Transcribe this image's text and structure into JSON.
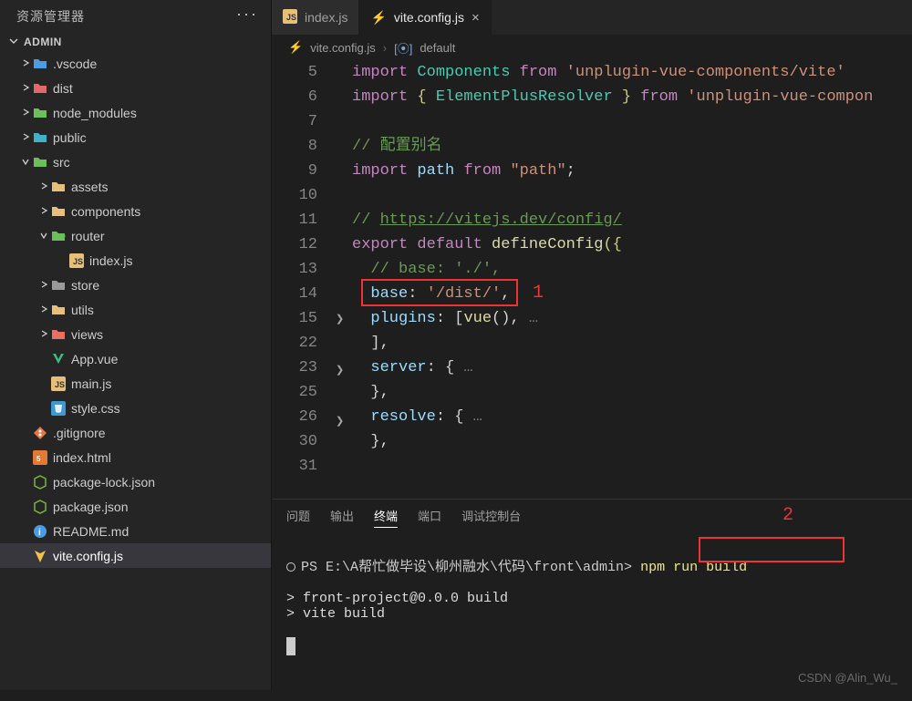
{
  "sidebar": {
    "title": "资源管理器",
    "project": "ADMIN",
    "tree": [
      {
        "chev": ">",
        "icon": "folder-vscode",
        "color": "#4a9de0",
        "label": ".vscode",
        "ind": 1
      },
      {
        "chev": ">",
        "icon": "folder-dist",
        "color": "#e06a6a",
        "label": "dist",
        "ind": 1
      },
      {
        "chev": ">",
        "icon": "folder-node",
        "color": "#6dbd5a",
        "label": "node_modules",
        "ind": 1
      },
      {
        "chev": ">",
        "icon": "folder-public",
        "color": "#3fb1c8",
        "label": "public",
        "ind": 1
      },
      {
        "chev": "v",
        "icon": "folder-src",
        "color": "#6dbd5a",
        "label": "src",
        "ind": 1
      },
      {
        "chev": ">",
        "icon": "folder",
        "color": "#e6c07b",
        "label": "assets",
        "ind": 2
      },
      {
        "chev": ">",
        "icon": "folder",
        "color": "#e6c07b",
        "label": "components",
        "ind": 2
      },
      {
        "chev": "v",
        "icon": "folder-open",
        "color": "#6dbd5a",
        "label": "router",
        "ind": 2
      },
      {
        "chev": "",
        "icon": "js",
        "color": "#e6c07b",
        "label": "index.js",
        "ind": 3
      },
      {
        "chev": ">",
        "icon": "folder",
        "color": "#9a9a9a",
        "label": "store",
        "ind": 2
      },
      {
        "chev": ">",
        "icon": "folder",
        "color": "#e6c07b",
        "label": "utils",
        "ind": 2
      },
      {
        "chev": ">",
        "icon": "folder",
        "color": "#e87060",
        "label": "views",
        "ind": 2
      },
      {
        "chev": "",
        "icon": "vue",
        "color": "#41b883",
        "label": "App.vue",
        "ind": 2
      },
      {
        "chev": "",
        "icon": "js",
        "color": "#e6c07b",
        "label": "main.js",
        "ind": 2
      },
      {
        "chev": "",
        "icon": "css",
        "color": "#3c99d4",
        "label": "style.css",
        "ind": 2
      },
      {
        "chev": "",
        "icon": "git",
        "color": "#e27748",
        "label": ".gitignore",
        "ind": 1
      },
      {
        "chev": "",
        "icon": "html",
        "color": "#e37933",
        "label": "index.html",
        "ind": 1
      },
      {
        "chev": "",
        "icon": "node",
        "color": "#7cb342",
        "label": "package-lock.json",
        "ind": 1
      },
      {
        "chev": "",
        "icon": "node",
        "color": "#7cb342",
        "label": "package.json",
        "ind": 1
      },
      {
        "chev": "",
        "icon": "info",
        "color": "#4a9de0",
        "label": "README.md",
        "ind": 1
      },
      {
        "chev": "",
        "icon": "vite",
        "color": "#f3c24b",
        "label": "vite.config.js",
        "ind": 1,
        "selected": true
      }
    ]
  },
  "tabs": [
    {
      "icon": "js",
      "label": "index.js",
      "active": false
    },
    {
      "icon": "vite",
      "label": "vite.config.js",
      "active": true,
      "close": "×"
    }
  ],
  "breadcrumb": {
    "file": "vite.config.js",
    "symbol": "default"
  },
  "code_lines": [
    {
      "n": 5,
      "html": "<span class='kw'>import</span> <span class='cls'>Components</span> <span class='kw'>from</span> <span class='str'>'unplugin-vue-components/vite'</span>"
    },
    {
      "n": 6,
      "html": "<span class='kw'>import</span> <span class='punc-y'>{</span> <span class='cls'>ElementPlusResolver</span> <span class='punc-y'>}</span> <span class='kw'>from</span> <span class='str'>'unplugin-vue-compon</span>"
    },
    {
      "n": 7,
      "html": ""
    },
    {
      "n": 8,
      "html": "<span class='cmt'>// 配置别名</span>"
    },
    {
      "n": 9,
      "html": "<span class='kw'>import</span> <span class='id'>path</span> <span class='kw'>from</span> <span class='str'>\"path\"</span><span class='punc'>;</span>"
    },
    {
      "n": 10,
      "html": ""
    },
    {
      "n": 11,
      "html": "<span class='cmt'>// <span class='link'>https://vitejs.dev/config/</span></span>"
    },
    {
      "n": 12,
      "html": "<span class='kw'>export</span> <span class='kw'>default</span> <span class='fn'>defineConfig</span><span class='punc-y'>({</span>"
    },
    {
      "n": 13,
      "html": "  <span class='cmt'>// base: './',</span>"
    },
    {
      "n": 14,
      "html": "  <span class='id'>base</span><span class='punc'>:</span> <span class='str'>'/dist/'</span><span class='punc'>,</span>"
    },
    {
      "n": 15,
      "fold": ">",
      "html": "  <span class='id'>plugins</span><span class='punc'>:</span> <span class='punc'>[</span><span class='fn'>vue</span><span class='punc'>(),</span><span class='ellip'> …</span>"
    },
    {
      "n": 22,
      "html": "  <span class='punc'>],</span>"
    },
    {
      "n": 23,
      "fold": ">",
      "html": "  <span class='id'>server</span><span class='punc'>:</span> <span class='punc'>{</span><span class='ellip'> …</span>"
    },
    {
      "n": 25,
      "html": "  <span class='punc'>},</span>"
    },
    {
      "n": 26,
      "fold": ">",
      "html": "  <span class='id'>resolve</span><span class='punc'>:</span> <span class='punc'>{</span><span class='ellip'> …</span>"
    },
    {
      "n": 30,
      "html": "  <span class='punc'>},</span>"
    },
    {
      "n": 31,
      "html": ""
    }
  ],
  "panel": {
    "tabs": [
      "问题",
      "输出",
      "终端",
      "端口",
      "调试控制台"
    ],
    "active": "终端",
    "prompt_path": "PS E:\\A帮忙做毕设\\柳州融水\\代码\\front\\admin>",
    "cmd": "npm run build",
    "out1": "> front-project@0.0.0 build",
    "out2": "> vite build"
  },
  "annotation": {
    "num1": "1",
    "num2": "2"
  },
  "watermark": "CSDN @Alin_Wu_"
}
